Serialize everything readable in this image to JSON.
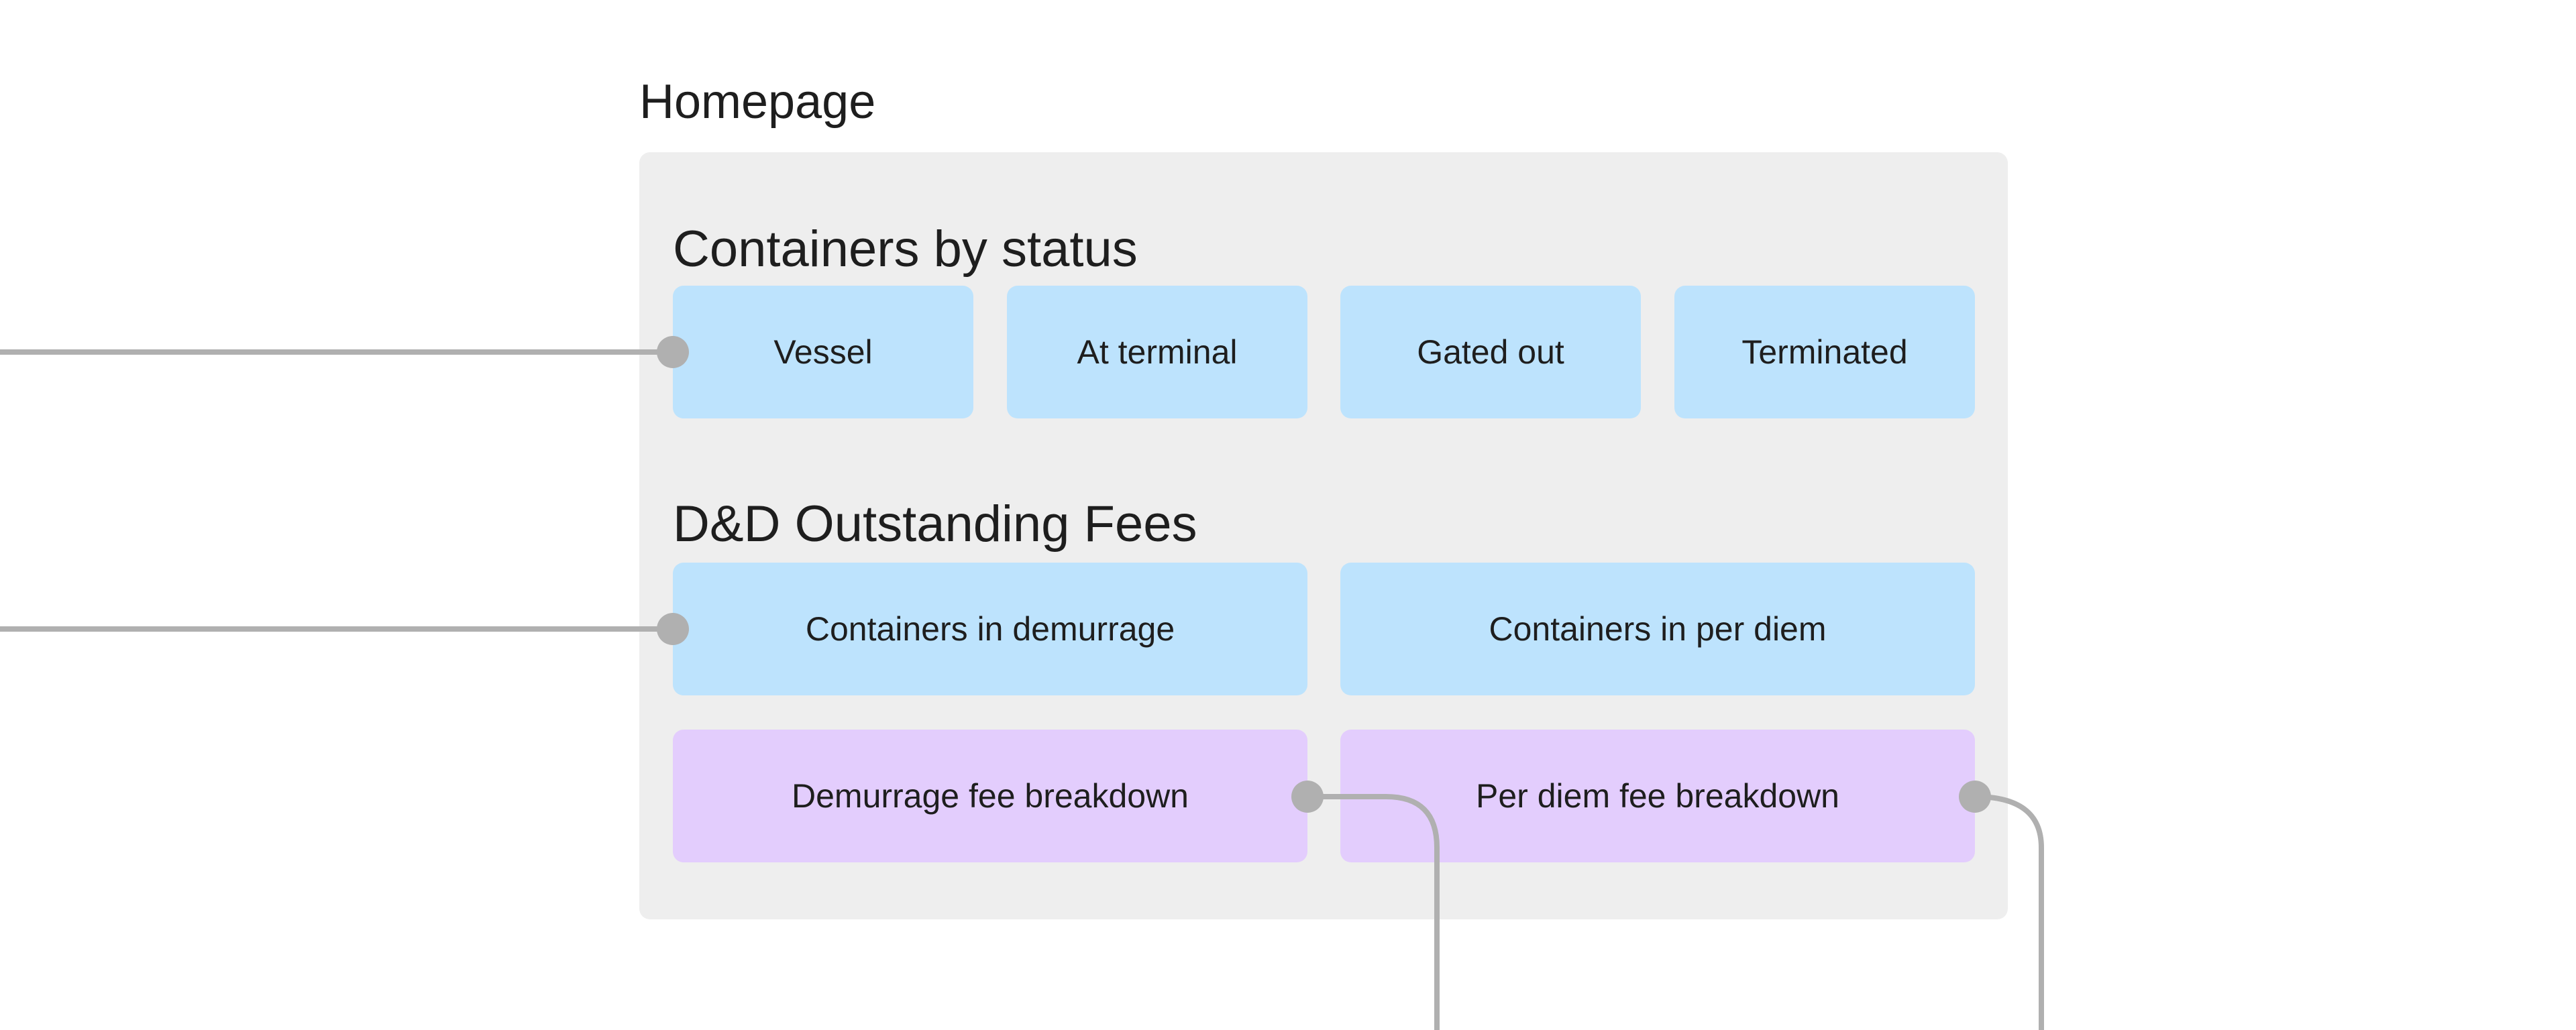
{
  "page": {
    "title": "Homepage"
  },
  "sections": {
    "status": {
      "title": "Containers by status",
      "cards": [
        "Vessel",
        "At terminal",
        "Gated out",
        "Terminated"
      ]
    },
    "fees": {
      "title": "D&D Outstanding Fees",
      "cards": [
        "Containers in demurrage",
        "Containers in per diem"
      ],
      "breakdowns": [
        "Demurrage fee breakdown",
        "Per diem fee breakdown"
      ]
    }
  },
  "colors": {
    "frame": "#eeeeee",
    "card_blue": "#bde3fd",
    "card_purple": "#e3cdfd",
    "connector": "#b0b0b0"
  }
}
